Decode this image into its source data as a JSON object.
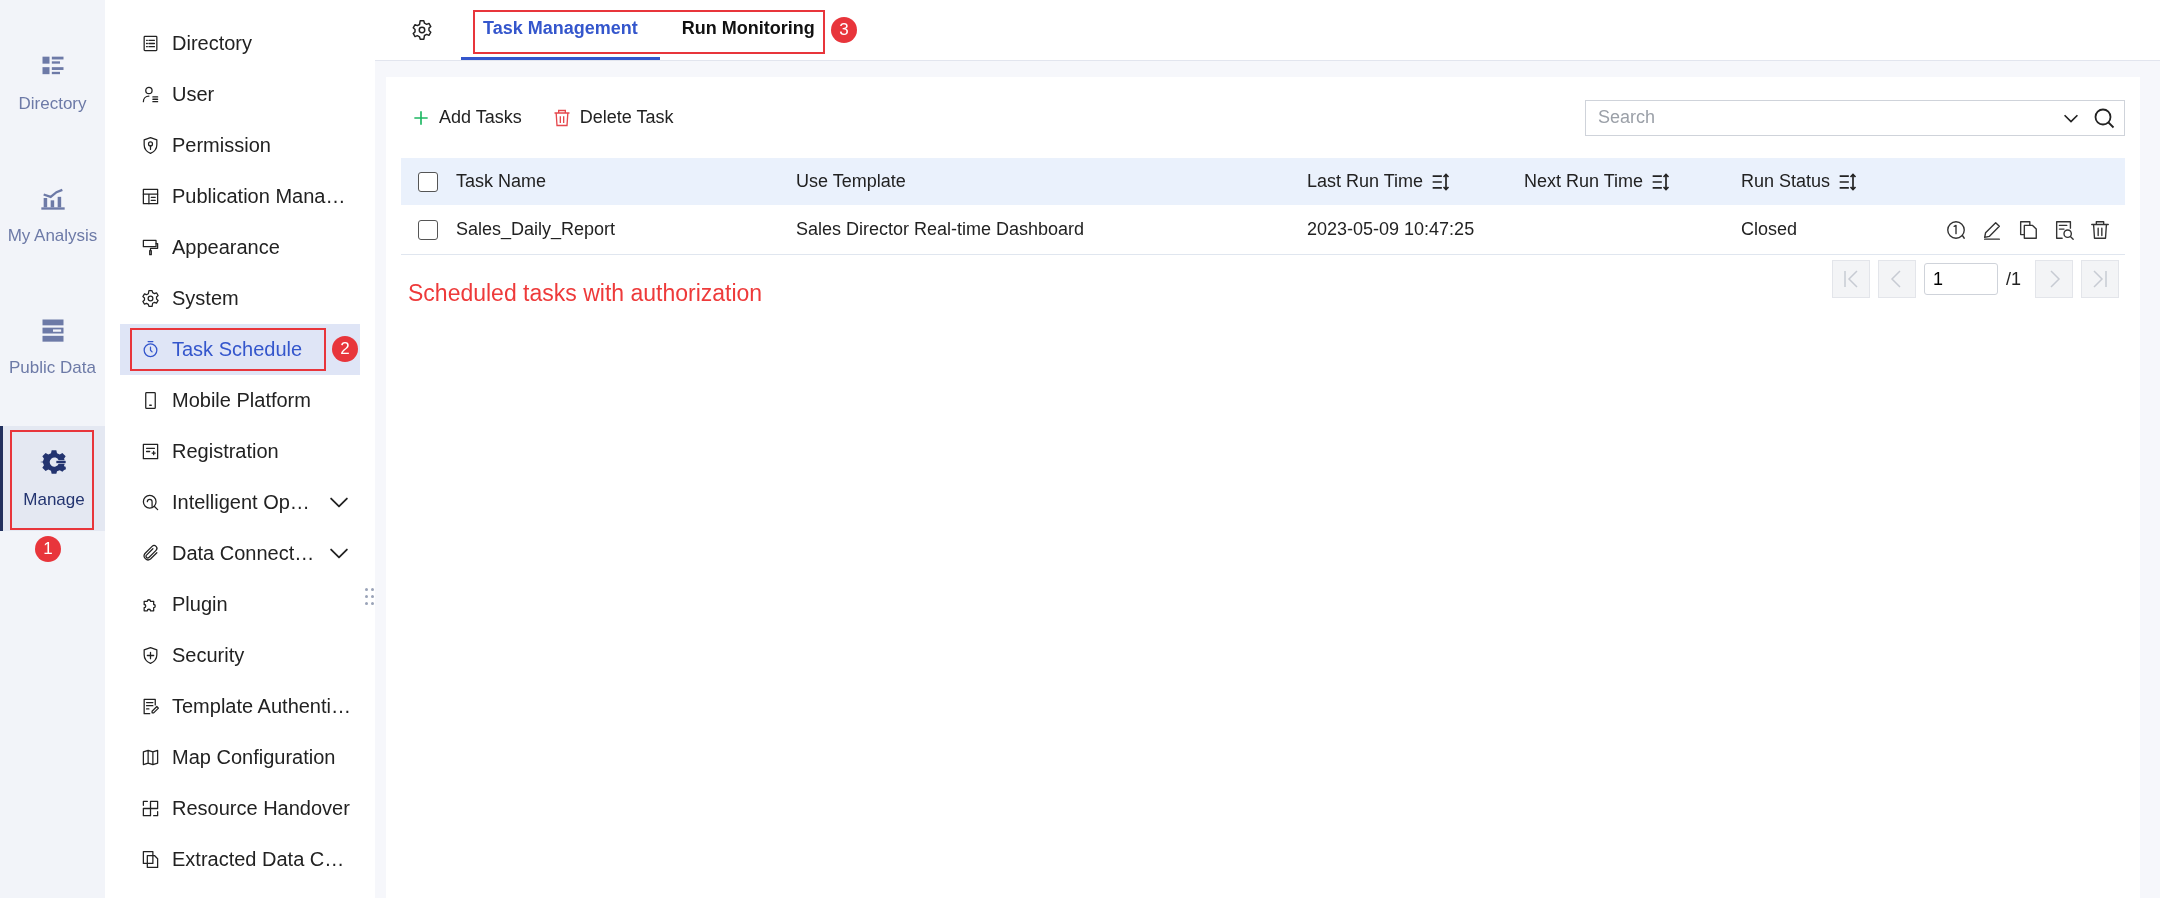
{
  "rail": [
    {
      "label": "Directory",
      "selected": false
    },
    {
      "label": "My Analysis",
      "selected": false
    },
    {
      "label": "Public Data",
      "selected": false
    },
    {
      "label": "Manage",
      "selected": true,
      "callout": "1"
    }
  ],
  "menu": [
    {
      "label": "Directory",
      "selected": false,
      "expandable": false
    },
    {
      "label": "User",
      "selected": false,
      "expandable": false
    },
    {
      "label": "Permission",
      "selected": false,
      "expandable": false
    },
    {
      "label": "Publication Mana…",
      "selected": false,
      "expandable": false
    },
    {
      "label": "Appearance",
      "selected": false,
      "expandable": false
    },
    {
      "label": "System",
      "selected": false,
      "expandable": false
    },
    {
      "label": "Task Schedule",
      "selected": true,
      "expandable": false,
      "callout": "2"
    },
    {
      "label": "Mobile Platform",
      "selected": false,
      "expandable": false
    },
    {
      "label": "Registration",
      "selected": false,
      "expandable": false
    },
    {
      "label": "Intelligent Op…",
      "selected": false,
      "expandable": true
    },
    {
      "label": "Data Connect…",
      "selected": false,
      "expandable": true
    },
    {
      "label": "Plugin",
      "selected": false,
      "expandable": false
    },
    {
      "label": "Security",
      "selected": false,
      "expandable": false
    },
    {
      "label": "Template Authenti…",
      "selected": false,
      "expandable": false
    },
    {
      "label": "Map Configuration",
      "selected": false,
      "expandable": false
    },
    {
      "label": "Resource Handover",
      "selected": false,
      "expandable": false
    },
    {
      "label": "Extracted Data C…",
      "selected": false,
      "expandable": false
    }
  ],
  "tabs": {
    "callout": "3",
    "items": [
      {
        "label": "Task Management",
        "selected": true
      },
      {
        "label": "Run Monitoring",
        "selected": false
      }
    ]
  },
  "toolbar": [
    {
      "label": "Add Tasks",
      "kind": "add"
    },
    {
      "label": "Delete Task",
      "kind": "delete"
    }
  ],
  "search": {
    "placeholder": "Search"
  },
  "table": {
    "select_all_checked": false,
    "columns": [
      {
        "label": "Task Name",
        "sortable": false
      },
      {
        "label": "Use Template",
        "sortable": false
      },
      {
        "label": "Last Run Time",
        "sortable": true
      },
      {
        "label": "Next Run Time",
        "sortable": true
      },
      {
        "label": "Run Status",
        "sortable": true
      }
    ],
    "rows": [
      {
        "checked": false,
        "cells": [
          "Sales_Daily_Report",
          "Sales Director Real-time Dashboard",
          "2023-05-09 10:47:25",
          null,
          "Closed"
        ]
      }
    ]
  },
  "pagination": {
    "page": "1",
    "total": "/1"
  },
  "note": "Scheduled tasks with authorization"
}
